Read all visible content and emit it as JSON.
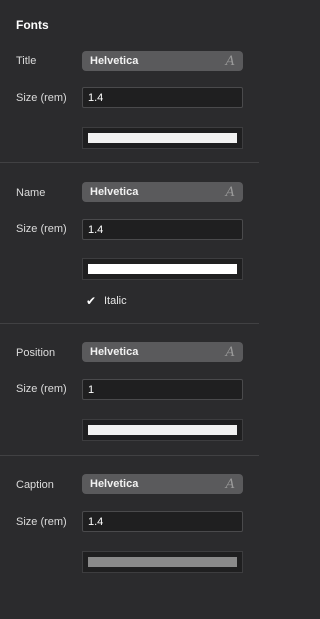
{
  "panel": {
    "heading": "Fonts"
  },
  "sections": {
    "title": {
      "label": "Title",
      "font": "Helvetica",
      "size_label": "Size (rem)",
      "size": "1.4",
      "color": "#f2f2f2"
    },
    "name": {
      "label": "Name",
      "font": "Helvetica",
      "size_label": "Size (rem)",
      "size": "1.4",
      "color": "#ffffff",
      "italic_label": "Italic",
      "italic_checked": true
    },
    "position": {
      "label": "Position",
      "font": "Helvetica",
      "size_label": "Size (rem)",
      "size": "1",
      "color": "#f2f2f2"
    },
    "caption": {
      "label": "Caption",
      "font": "Helvetica",
      "size_label": "Size (rem)",
      "size": "1.4",
      "color": "#8a8a8a"
    }
  },
  "icons": {
    "font_picker": "font-picker-icon",
    "checkbox": "checkmark-icon"
  },
  "glyphs": {
    "font_picker": "𝐴",
    "check": "✔"
  }
}
